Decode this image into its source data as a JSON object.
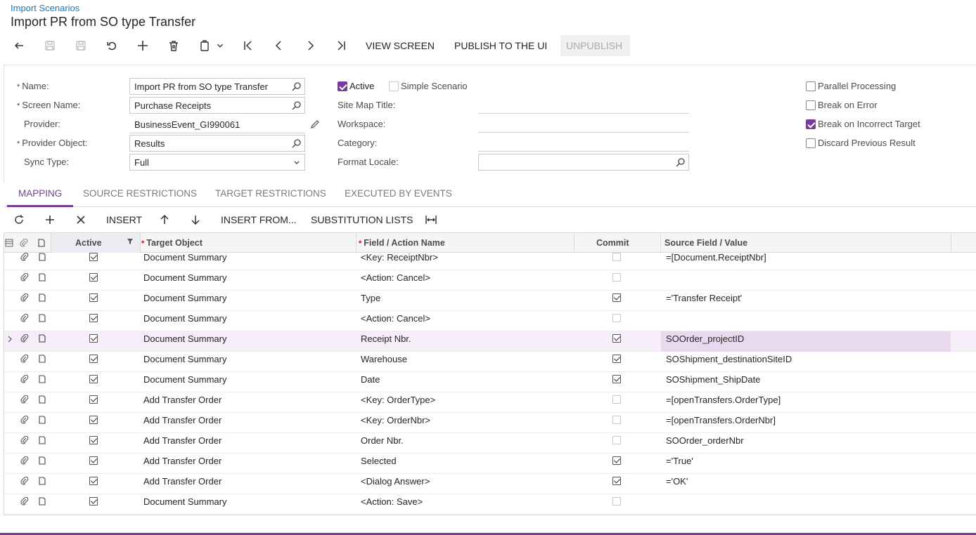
{
  "breadcrumb": "Import Scenarios",
  "title": "Import PR from SO type Transfer",
  "toolbar": {
    "view_screen": "VIEW SCREEN",
    "publish": "PUBLISH TO THE UI",
    "unpublish": "UNPUBLISH"
  },
  "form": {
    "name_label": "Name:",
    "name_value": "Import PR from SO type Transfer",
    "screen_label": "Screen Name:",
    "screen_value": "Purchase Receipts",
    "provider_label": "Provider:",
    "provider_value": "BusinessEvent_GI990061",
    "provider_object_label": "Provider Object:",
    "provider_object_value": "Results",
    "sync_label": "Sync Type:",
    "sync_value": "Full",
    "active_label": "Active",
    "active_checked": true,
    "simple_label": "Simple Scenario",
    "simple_checked": false,
    "sitemap_label": "Site Map Title:",
    "workspace_label": "Workspace:",
    "category_label": "Category:",
    "locale_label": "Format Locale:",
    "parallel_label": "Parallel Processing",
    "parallel_checked": false,
    "break_error_label": "Break on Error",
    "break_error_checked": false,
    "break_target_label": "Break on Incorrect Target",
    "break_target_checked": true,
    "discard_label": "Discard Previous Result",
    "discard_checked": false
  },
  "tabs": [
    "MAPPING",
    "SOURCE RESTRICTIONS",
    "TARGET RESTRICTIONS",
    "EXECUTED BY EVENTS"
  ],
  "gridbar": {
    "insert": "INSERT",
    "insert_from": "INSERT FROM...",
    "substitution": "SUBSTITUTION LISTS"
  },
  "columns": {
    "active": "Active",
    "target": "Target Object",
    "field": "Field / Action Name",
    "commit": "Commit",
    "source": "Source Field / Value"
  },
  "rows": [
    {
      "active": true,
      "target": "Document Summary",
      "field": "<Key: ReceiptNbr>",
      "commit": false,
      "source": "=[Document.ReceiptNbr]"
    },
    {
      "active": true,
      "target": "Document Summary",
      "field": "<Action: Cancel>",
      "commit": false,
      "source": ""
    },
    {
      "active": true,
      "target": "Document Summary",
      "field": "Type",
      "commit": true,
      "source": "='Transfer Receipt'"
    },
    {
      "active": true,
      "target": "Document Summary",
      "field": "<Action: Cancel>",
      "commit": false,
      "source": ""
    },
    {
      "active": true,
      "target": "Document Summary",
      "field": "Receipt Nbr.",
      "commit": true,
      "source": "SOOrder_projectID",
      "selected": true
    },
    {
      "active": true,
      "target": "Document Summary",
      "field": "Warehouse",
      "commit": true,
      "source": "SOShipment_destinationSiteID"
    },
    {
      "active": true,
      "target": "Document Summary",
      "field": "Date",
      "commit": true,
      "source": "SOShipment_ShipDate"
    },
    {
      "active": true,
      "target": "Add Transfer Order",
      "field": "<Key: OrderType>",
      "commit": false,
      "source": "=[openTransfers.OrderType]"
    },
    {
      "active": true,
      "target": "Add Transfer Order",
      "field": "<Key: OrderNbr>",
      "commit": false,
      "source": "=[openTransfers.OrderNbr]"
    },
    {
      "active": true,
      "target": "Add Transfer Order",
      "field": "Order Nbr.",
      "commit": false,
      "source": "SOOrder_orderNbr"
    },
    {
      "active": true,
      "target": "Add Transfer Order",
      "field": "Selected",
      "commit": true,
      "source": "='True'"
    },
    {
      "active": true,
      "target": "Add Transfer Order",
      "field": "<Dialog Answer>",
      "commit": true,
      "source": "='OK'"
    },
    {
      "active": true,
      "target": "Document Summary",
      "field": "<Action: Save>",
      "commit": false,
      "source": ""
    }
  ]
}
